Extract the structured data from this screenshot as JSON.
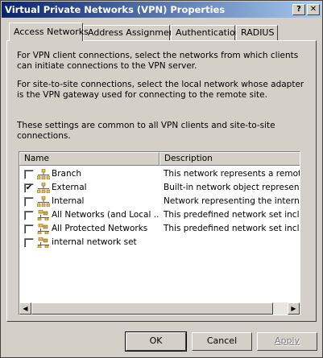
{
  "window": {
    "title": "Virtual Private Networks (VPN) Properties",
    "help_label": "?",
    "close_label": "✕"
  },
  "tabs": [
    {
      "label": "Access Networks"
    },
    {
      "label": "Address Assignment"
    },
    {
      "label": "Authentication"
    },
    {
      "label": "RADIUS"
    }
  ],
  "text": {
    "p1": "For VPN client connections, select the networks from which clients can initiate connections to the VPN server.",
    "p2": "For site-to-site connections, select the local network whose adapter is the VPN gateway used for connecting to the remote site.",
    "p3": "These settings are common to all VPN clients and site-to-site connections."
  },
  "list": {
    "columns": [
      "Name",
      "Description"
    ],
    "rows": [
      {
        "name": "Branch",
        "desc": "This network represents a remote V",
        "checked": false,
        "icon": "network-icon"
      },
      {
        "name": "External",
        "desc": "Built-in network object representing",
        "checked": true,
        "icon": "network-icon"
      },
      {
        "name": "Internal",
        "desc": "Network representing the internal n",
        "checked": false,
        "icon": "network-icon"
      },
      {
        "name": "All Networks (and Local ...",
        "desc": "This predefined network set include",
        "checked": false,
        "icon": "network-set-icon"
      },
      {
        "name": "All Protected Networks",
        "desc": "This predefined network set include",
        "checked": false,
        "icon": "network-set-icon"
      },
      {
        "name": "internal network set",
        "desc": "",
        "checked": false,
        "icon": "network-set-icon"
      }
    ]
  },
  "buttons": {
    "ok": "OK",
    "cancel": "Cancel",
    "apply": "Apply"
  },
  "colors": {
    "titlebar_start": "#0a246a",
    "titlebar_end": "#a6caf0",
    "face": "#d4d0c8"
  }
}
